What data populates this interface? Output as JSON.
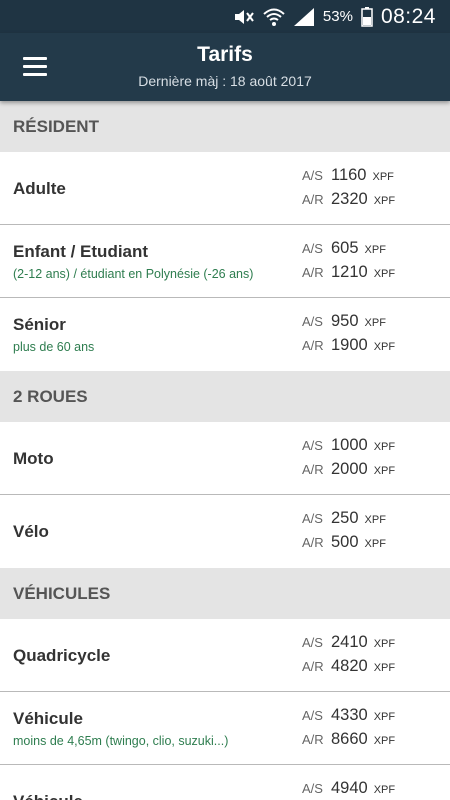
{
  "status_bar": {
    "icons": [
      "mute-icon",
      "wifi-icon",
      "signal-icon",
      "battery-icon"
    ],
    "battery": "53%",
    "time": "08:24"
  },
  "header": {
    "title": "Tarifs",
    "subtitle": "Dernière màj : 18 août 2017",
    "menu_icon": "menu-icon"
  },
  "colors": {
    "appbar": "#233a4a",
    "statusbar": "#1f3443",
    "section_bg": "#e4e4e4",
    "subtitle_green": "#2e7d4f"
  },
  "sections": [
    {
      "title": "RÉSIDENT",
      "rows": [
        {
          "title": "Adulte",
          "subtitle": "",
          "prices": [
            {
              "label": "A/S",
              "value": "1160",
              "unit": "XPF"
            },
            {
              "label": "A/R",
              "value": "2320",
              "unit": "XPF"
            }
          ]
        },
        {
          "title": "Enfant / Etudiant",
          "subtitle": "(2-12 ans) / étudiant en Polynésie (-26 ans)",
          "prices": [
            {
              "label": "A/S",
              "value": "605",
              "unit": "XPF"
            },
            {
              "label": "A/R",
              "value": "1210",
              "unit": "XPF"
            }
          ]
        },
        {
          "title": "Sénior",
          "subtitle": "plus de 60 ans",
          "prices": [
            {
              "label": "A/S",
              "value": "950",
              "unit": "XPF"
            },
            {
              "label": "A/R",
              "value": "1900",
              "unit": "XPF"
            }
          ]
        }
      ]
    },
    {
      "title": "2 ROUES",
      "rows": [
        {
          "title": "Moto",
          "subtitle": "",
          "prices": [
            {
              "label": "A/S",
              "value": "1000",
              "unit": "XPF"
            },
            {
              "label": "A/R",
              "value": "2000",
              "unit": "XPF"
            }
          ]
        },
        {
          "title": "Vélo",
          "subtitle": "",
          "prices": [
            {
              "label": "A/S",
              "value": "250",
              "unit": "XPF"
            },
            {
              "label": "A/R",
              "value": "500",
              "unit": "XPF"
            }
          ]
        }
      ]
    },
    {
      "title": "VÉHICULES",
      "rows": [
        {
          "title": "Quadricycle",
          "subtitle": "",
          "prices": [
            {
              "label": "A/S",
              "value": "2410",
              "unit": "XPF"
            },
            {
              "label": "A/R",
              "value": "4820",
              "unit": "XPF"
            }
          ]
        },
        {
          "title": "Véhicule",
          "subtitle": "moins de 4,65m (twingo, clio, suzuki...)",
          "prices": [
            {
              "label": "A/S",
              "value": "4330",
              "unit": "XPF"
            },
            {
              "label": "A/R",
              "value": "8660",
              "unit": "XPF"
            }
          ]
        },
        {
          "title": "Véhicule",
          "subtitle": "",
          "prices": [
            {
              "label": "A/S",
              "value": "4940",
              "unit": "XPF"
            }
          ]
        }
      ]
    }
  ]
}
